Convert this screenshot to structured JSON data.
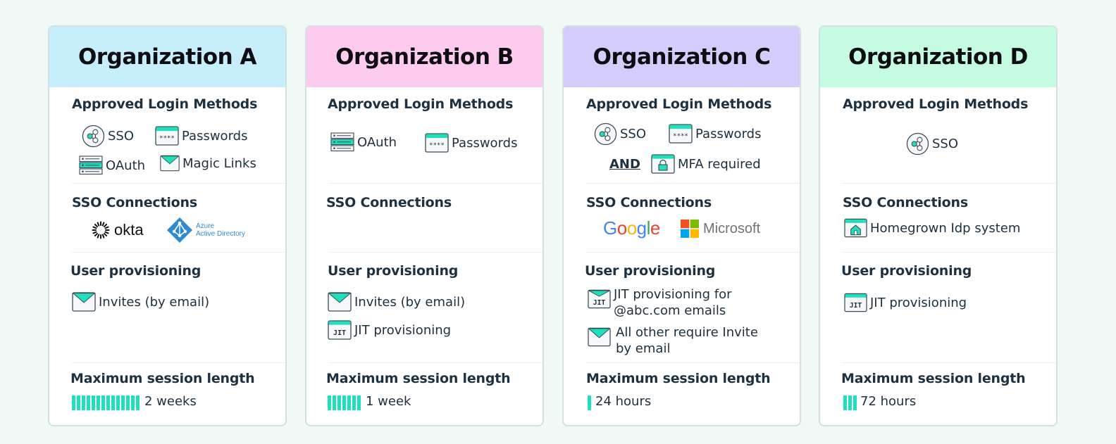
{
  "colors": {
    "accent": "#1fe0bd",
    "org_a_header": "#c7eefb",
    "org_b_header": "#fccbee",
    "org_c_header": "#d4cdfc",
    "org_d_header": "#c5fbe0"
  },
  "section_titles": {
    "login": "Approved Login Methods",
    "sso": "SSO Connections",
    "provisioning": "User provisioning",
    "session": "Maximum session length"
  },
  "organizations": [
    {
      "name": "Organization A",
      "login_methods": [
        {
          "icon": "sso-icon",
          "label": "SSO"
        },
        {
          "icon": "password-icon",
          "label": "Passwords"
        },
        {
          "icon": "oauth-icon",
          "label": "OAuth"
        },
        {
          "icon": "envelope-icon",
          "label": "Magic Links"
        }
      ],
      "sso_connections": [
        {
          "icon": "okta-logo",
          "label": "okta"
        },
        {
          "icon": "azure-ad-logo",
          "label_line1": "Azure",
          "label_line2": "Active Directory"
        }
      ],
      "provisioning": [
        {
          "icon": "envelope-icon",
          "label": "Invites (by email)"
        }
      ],
      "session": {
        "label": "2 weeks",
        "bar_count": 14
      }
    },
    {
      "name": "Organization B",
      "login_methods": [
        {
          "icon": "oauth-icon",
          "label": "OAuth"
        },
        {
          "icon": "password-icon",
          "label": "Passwords"
        }
      ],
      "sso_connections": [],
      "provisioning": [
        {
          "icon": "envelope-icon",
          "label": "Invites (by email)"
        },
        {
          "icon": "jit-icon",
          "label": "JIT provisioning"
        }
      ],
      "session": {
        "label": "1 week",
        "bar_count": 7
      }
    },
    {
      "name": "Organization C",
      "login_methods": [
        {
          "icon": "sso-icon",
          "label": "SSO"
        },
        {
          "icon": "password-icon",
          "label": "Passwords"
        },
        {
          "icon": "mfa-lock-icon",
          "label": "MFA required"
        }
      ],
      "and_label": "AND",
      "sso_connections": [
        {
          "icon": "google-logo",
          "label": "Google"
        },
        {
          "icon": "microsoft-logo",
          "label": "Microsoft"
        }
      ],
      "provisioning": [
        {
          "icon": "jit-envelope-icon",
          "label_line1": "JIT provisioning for",
          "label_line2": "@abc.com emails"
        },
        {
          "icon": "envelope-icon",
          "label_line1": "All other require Invite",
          "label_line2": "by email"
        }
      ],
      "session": {
        "label": "24 hours",
        "bar_count": 1
      }
    },
    {
      "name": "Organization D",
      "login_methods": [
        {
          "icon": "sso-icon",
          "label": "SSO"
        }
      ],
      "sso_connections": [
        {
          "icon": "homegrown-idp-icon",
          "label": "Homegrown Idp system"
        }
      ],
      "provisioning": [
        {
          "icon": "jit-icon",
          "label": "JIT provisioning"
        }
      ],
      "session": {
        "label": "72 hours",
        "bar_count": 3
      }
    }
  ]
}
